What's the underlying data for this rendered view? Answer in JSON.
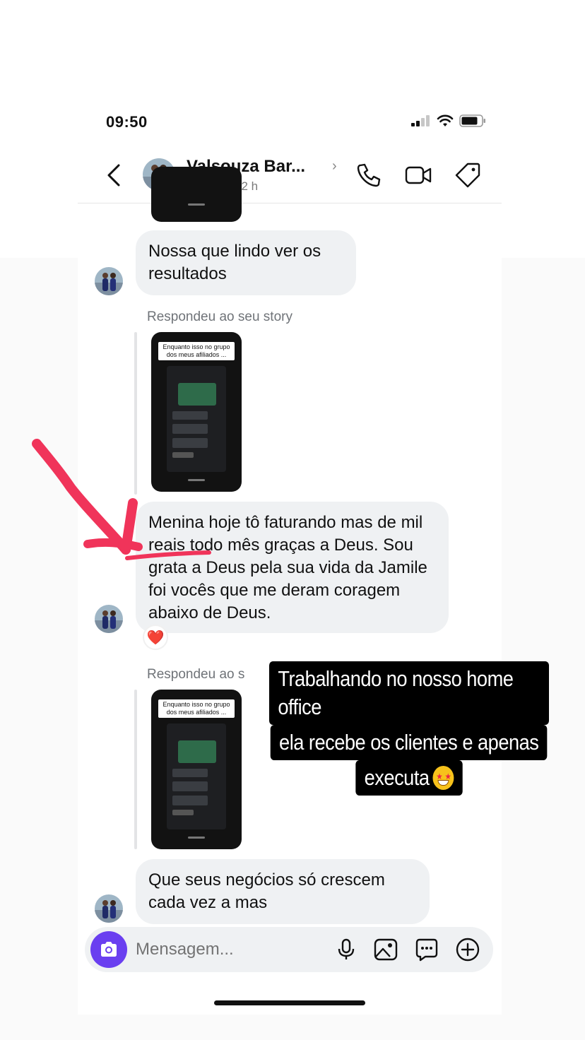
{
  "status_bar": {
    "time": "09:50"
  },
  "header": {
    "name": "Valsouza Bar...",
    "status": "Online há 2 h"
  },
  "messages": [
    {
      "text": "Nossa que lindo ver os resultados"
    },
    {
      "reply_label": "Respondeu ao seu story",
      "story_caption": "Enquanto isso no grupo dos meus afiliados ..."
    },
    {
      "text": "Menina hoje tô faturando mas de mil reais todo mês graças a Deus.  Sou grata a Deus pela sua vida da Jamile foi vocês que me deram coragem abaixo de Deus.",
      "reaction": "❤️"
    },
    {
      "reply_label": "Respondeu ao s",
      "story_caption": "Enquanto isso no grupo dos meus afiliados ..."
    },
    {
      "text": "Que seus negócios só crescem cada vez a mas"
    }
  ],
  "composer": {
    "placeholder": "Mensagem..."
  },
  "overlay": {
    "line1": "Trabalhando no nosso home office",
    "line2": "ela recebe os clientes e apenas",
    "line3": "executa",
    "emoji": "star-struck-emoji"
  },
  "colors": {
    "camera_button": "#6a3ff0",
    "bubble": "#eff1f3",
    "annotation_arrow": "#f0345a",
    "overlay_bg": "#000000"
  }
}
